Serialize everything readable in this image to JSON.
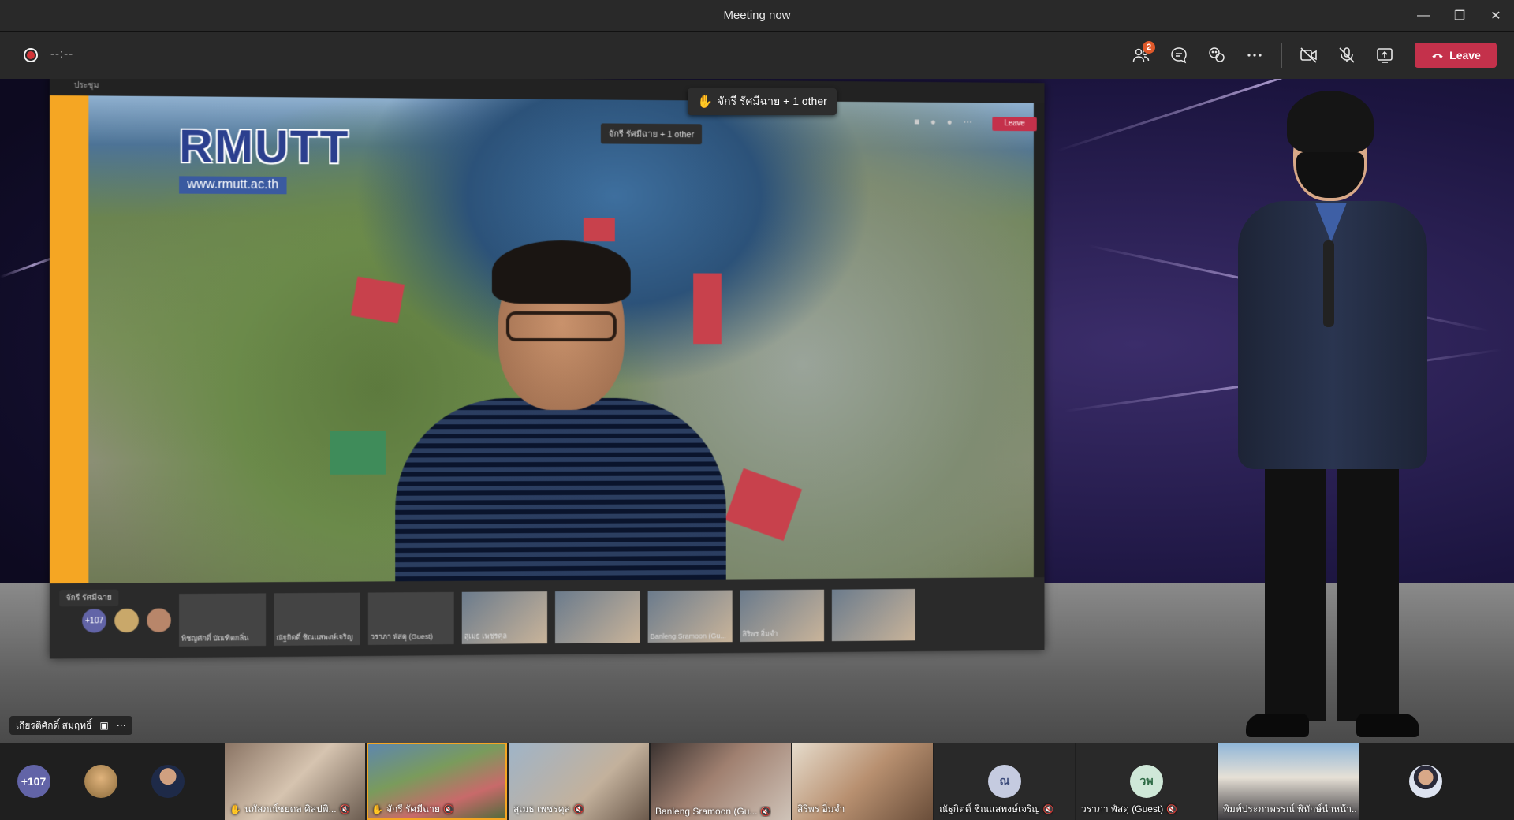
{
  "window": {
    "title": "Meeting now",
    "controls": [
      "minimize-icon",
      "restore-icon",
      "close-icon"
    ]
  },
  "toolbar": {
    "timer": "--:--",
    "participants_badge": "2",
    "icons": [
      "participants-icon",
      "chat-icon",
      "reactions-icon",
      "more-icon",
      "camera-off-icon",
      "mic-off-icon",
      "share-icon"
    ],
    "leave_label": "Leave",
    "leave_color": "#c4314b"
  },
  "stage": {
    "raised_hand_toast": "จักรี รัศมีฉาย + 1 other",
    "shared_screen": {
      "logo_text": "RMUTT",
      "logo_sub": "www.rmutt.ac.th",
      "inner_title": "ประชุม",
      "inner_hand_toast": "จักรี รัศมีฉาย + 1 other",
      "inner_leave": "Leave",
      "inner_name_tag": "จักรี รัศมีฉาย",
      "inner_strip": {
        "overflow": "+107",
        "tiles": [
          "พิชญศักดิ์ บัณฑิตกลิ่น",
          "ณัฐกิตติ์ ชิณแสพงษ์เจริญ",
          "วราภา พัสดุ (Guest)",
          "สุเมธ เพชรคุล",
          "",
          "Banleng Sramoon (Gu...",
          "สิริพร อิ่มจำ",
          "",
          ""
        ]
      }
    },
    "spotlight_name": "เกียรติศักดิ์ สมฤทธิ์"
  },
  "gallery": {
    "overflow": "+107",
    "avatar_initials": [
      "ณ",
      "วพ"
    ],
    "tiles": [
      {
        "name": "นภัสภณ์ชยดล ศิลปพิ...",
        "hand": true,
        "muted": true
      },
      {
        "name": "จักรี รัศมีฉาย",
        "hand": true,
        "muted": true,
        "active": true
      },
      {
        "name": "สุเมธ เพชรคุล",
        "hand": false,
        "muted": true
      },
      {
        "name": "Banleng Sramoon (Gu...",
        "hand": false,
        "muted": true
      },
      {
        "name": "สิริพร อิ่มจำ",
        "hand": false,
        "muted": false
      },
      {
        "name": "ณัฐกิตติ์ ชิณแสพงษ์เจริญ",
        "hand": false,
        "muted": true,
        "initials": "ณ"
      },
      {
        "name": "วราภา พัสดุ (Guest)",
        "hand": false,
        "muted": true,
        "initials": "วพ"
      },
      {
        "name": "พิมพ์ประภาพรรณ์ พิทักษ์นำหน้า...",
        "hand": false,
        "muted": false
      }
    ]
  }
}
